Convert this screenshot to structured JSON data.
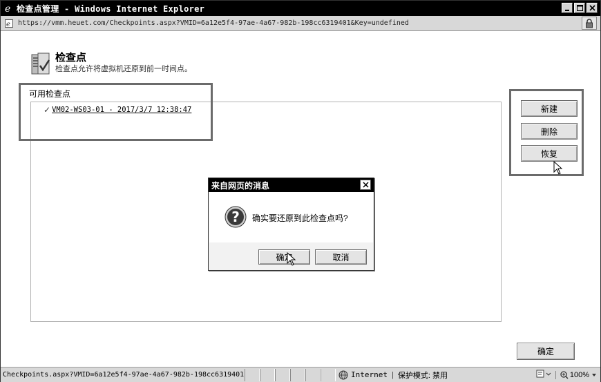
{
  "window": {
    "title": "检查点管理 - Windows Internet Explorer",
    "controls": [
      "minimize",
      "maximize",
      "close"
    ]
  },
  "address": {
    "url": "https://vmm.heuet.com/Checkpoints.aspx?VMID=6a12e5f4-97ae-4a67-982b-198cc6319401&Key=undefined"
  },
  "page": {
    "title": "检查点",
    "subtitle": "检查点允许将虚拟机还原到前一时间点。",
    "icon": "server-checkpoint-icon"
  },
  "checkpoints": {
    "section_label": "可用检查点",
    "items": [
      {
        "label": "VM02-WS03-01 - 2017/3/7 12:38:47",
        "checked": true
      }
    ]
  },
  "actions": {
    "new_label": "新建",
    "delete_label": "删除",
    "restore_label": "恢复",
    "ok_label": "确定"
  },
  "dialog": {
    "title": "来自网页的消息",
    "message": "确实要还原到此检查点吗?",
    "icon": "question-icon",
    "ok_label": "确定",
    "cancel_label": "取消"
  },
  "statusbar": {
    "url": "Checkpoints.aspx?VMID=6a12e5f4-97ae-4a67-982b-198cc6319401",
    "zone": "Internet",
    "protected_mode": "保护模式: 禁用",
    "zoom": "100%"
  }
}
